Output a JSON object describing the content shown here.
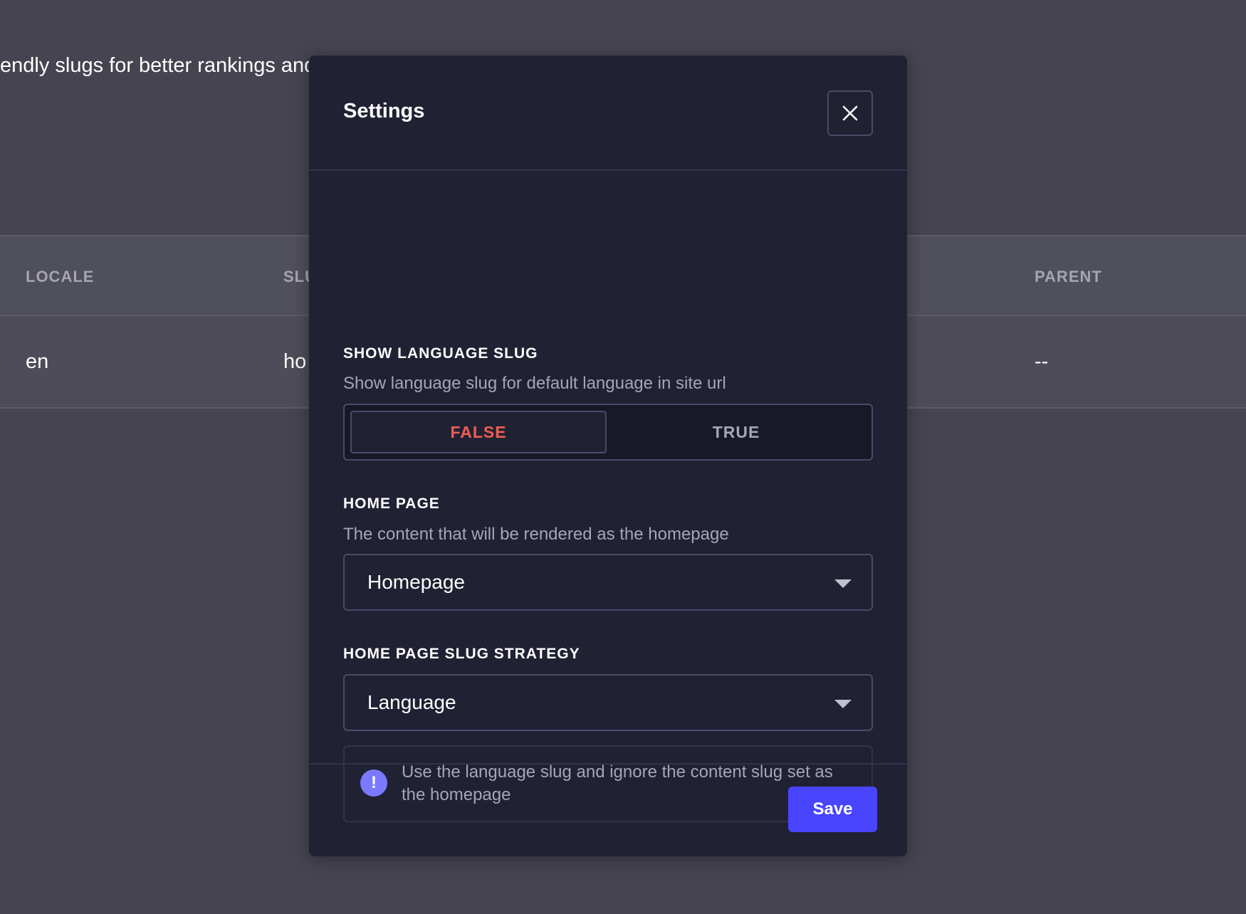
{
  "background": {
    "intro_text": "endly slugs for better rankings and",
    "table": {
      "headers": {
        "locale": "LOCALE",
        "slug": "SLU",
        "parent": "PARENT"
      },
      "row": {
        "locale": "en",
        "slug": "ho",
        "parent": "--"
      }
    }
  },
  "modal": {
    "title": "Settings",
    "close_icon": "close-icon",
    "show_language_slug": {
      "label": "SHOW LANGUAGE SLUG",
      "hint": "Show language slug for default language in site url",
      "options": [
        "FALSE",
        "TRUE"
      ],
      "selected": "FALSE"
    },
    "home_page": {
      "label": "HOME PAGE",
      "hint": "The content that will be rendered as the homepage",
      "value": "Homepage"
    },
    "slug_strategy": {
      "label": "HOME PAGE SLUG STRATEGY",
      "value": "Language",
      "info_icon_text": "!",
      "info": "Use the language slug and ignore the content slug set as the homepage"
    },
    "save_label": "Save"
  },
  "colors": {
    "accent": "#4945ff",
    "danger_text": "#ee5e52",
    "info_icon": "#7b79ff"
  }
}
